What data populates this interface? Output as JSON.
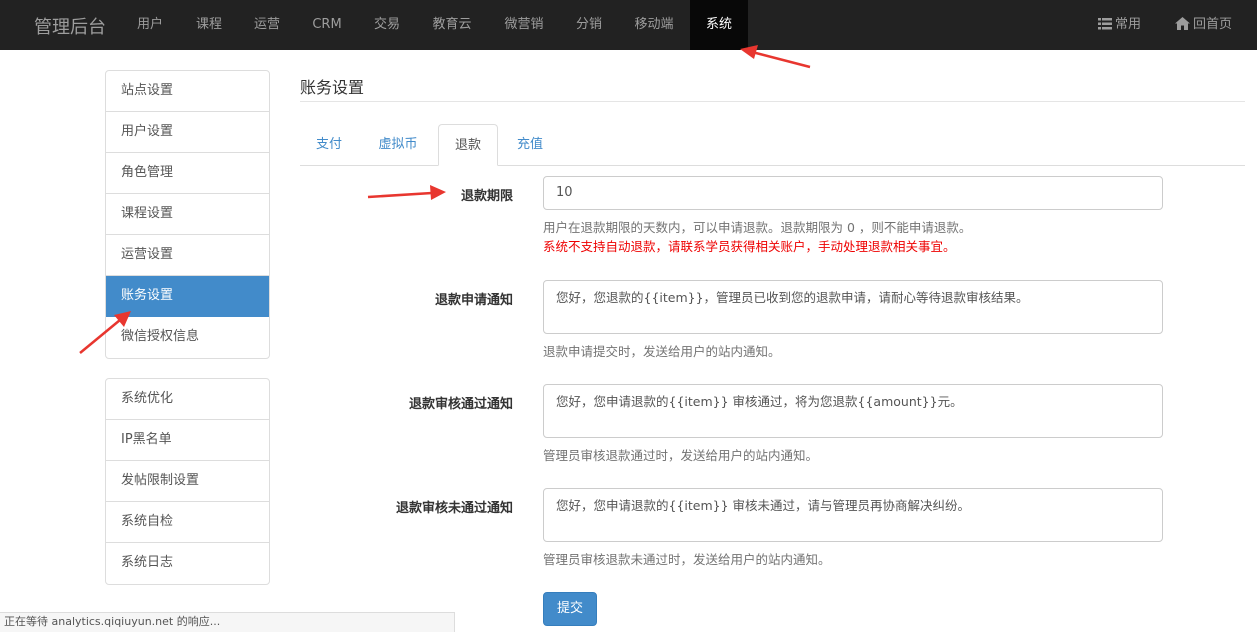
{
  "navbar": {
    "brand": "管理后台",
    "items": [
      "用户",
      "课程",
      "运营",
      "CRM",
      "交易",
      "教育云",
      "微营销",
      "分销",
      "移动端",
      "系统"
    ],
    "active_index": 9,
    "right": {
      "common_label": "常用",
      "home_label": "回首页"
    }
  },
  "sidebar": {
    "group1": [
      "站点设置",
      "用户设置",
      "角色管理",
      "课程设置",
      "运营设置",
      "账务设置",
      "微信授权信息"
    ],
    "group1_active_index": 5,
    "group2": [
      "系统优化",
      "IP黑名单",
      "发帖限制设置",
      "系统自检",
      "系统日志"
    ]
  },
  "main": {
    "title": "账务设置",
    "tabs": [
      "支付",
      "虚拟币",
      "退款",
      "充值"
    ],
    "active_tab_index": 2,
    "form": {
      "period_label": "退款期限",
      "period_value": "10",
      "period_help": "用户在退款期限的天数内，可以申请退款。退款期限为 0 ，则不能申请退款。",
      "period_warning": "系统不支持自动退款，请联系学员获得相关账户，手动处理退款相关事宜。",
      "apply_label": "退款申请通知",
      "apply_value": "您好，您退款的{{item}}，管理员已收到您的退款申请，请耐心等待退款审核结果。",
      "apply_help": "退款申请提交时，发送给用户的站内通知。",
      "approved_label": "退款审核通过通知",
      "approved_value": "您好，您申请退款的{{item}} 审核通过，将为您退款{{amount}}元。",
      "approved_help": "管理员审核退款通过时，发送给用户的站内通知。",
      "rejected_label": "退款审核未通过通知",
      "rejected_value": "您好，您申请退款的{{item}} 审核未通过，请与管理员再协商解决纠纷。",
      "rejected_help": "管理员审核退款未通过时，发送给用户的站内通知。",
      "submit_label": "提交"
    }
  },
  "statusbar": {
    "text": "正在等待 analytics.qiqiuyun.net 的响应..."
  },
  "colors": {
    "navbar_bg": "#222222",
    "accent": "#428bca",
    "warning": "#ee0000",
    "annotation_arrow": "#e8362f"
  },
  "icons": {
    "common": "list-icon",
    "home": "home-icon"
  }
}
